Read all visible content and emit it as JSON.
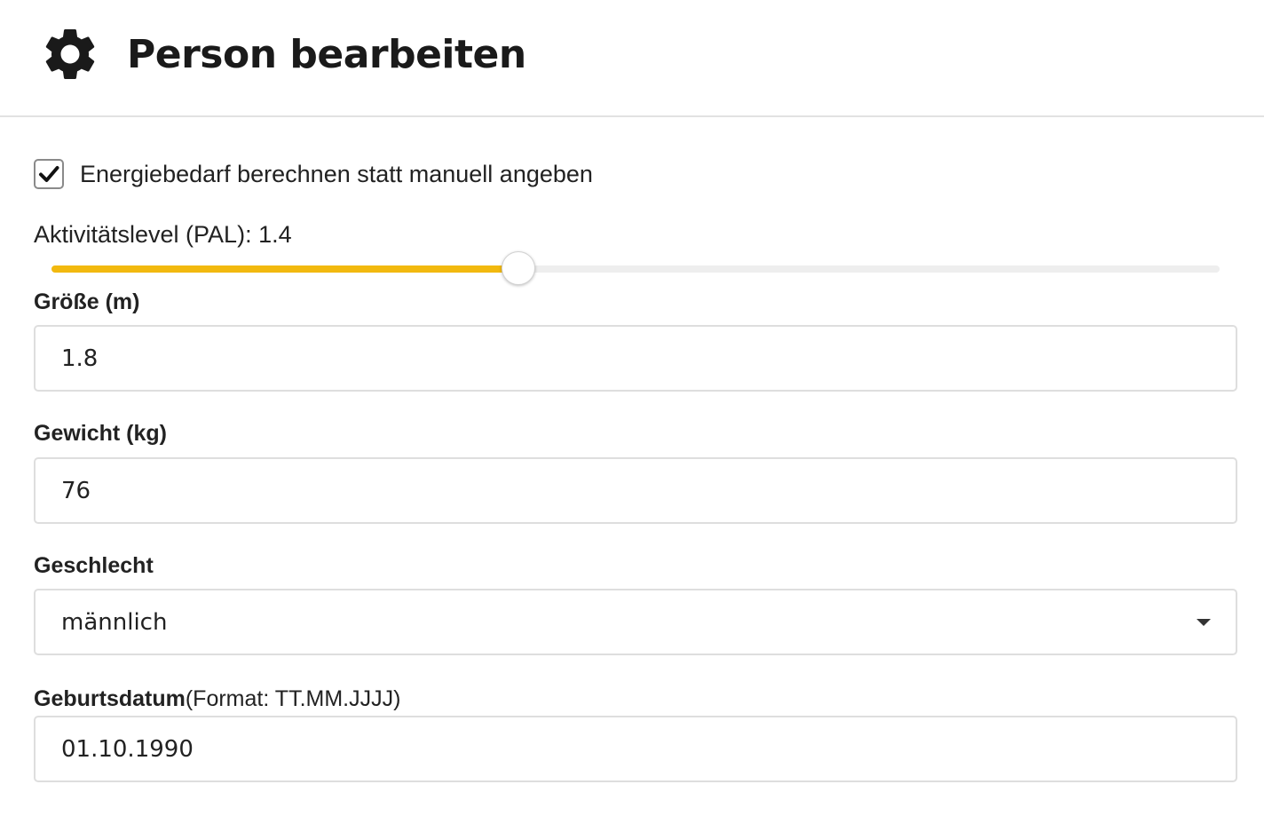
{
  "header": {
    "title": "Person bearbeiten",
    "icon": "gear-icon"
  },
  "energy_checkbox": {
    "checked": true,
    "label": "Energiebedarf berechnen statt manuell angeben"
  },
  "activity_slider": {
    "label": "Aktivitätslevel (PAL): 1.4",
    "value": 1.4,
    "fill_fraction": 0.4,
    "accent_color": "#f2b90f"
  },
  "height_field": {
    "label": "Größe (m)",
    "value": "1.8"
  },
  "weight_field": {
    "label": "Gewicht (kg)",
    "value": "76"
  },
  "gender_field": {
    "label": "Geschlecht",
    "value": "männlich"
  },
  "birthdate_field": {
    "label": "Geburtsdatum",
    "hint": "(Format: TT.MM.JJJJ)",
    "value": "01.10.1990"
  }
}
